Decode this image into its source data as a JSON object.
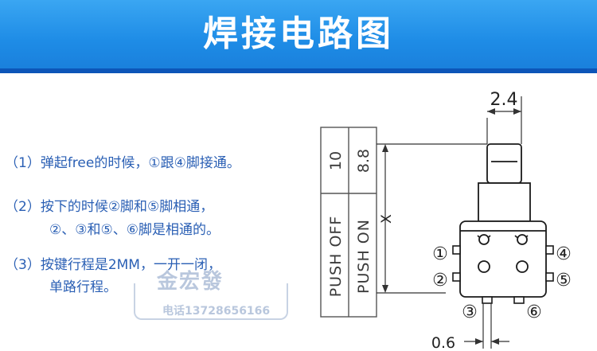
{
  "banner": {
    "title": "焊接电路图"
  },
  "notes": {
    "line1": "（1）弹起free的时候，①跟④脚接通。",
    "line2": "（2）按下的时候②脚和⑤脚相通，",
    "line3": "②、③和⑤、⑥脚是相通的。",
    "line4": "（3）按键行程是2MM，一开一闭，",
    "line5": "单路行程。"
  },
  "watermark": {
    "name": "金宏發",
    "phone": "电话13728656166"
  },
  "table": {
    "col1_value": "10",
    "col2_value": "8.8",
    "col1_label": "PUSH OFF",
    "col2_label": "PUSH ON"
  },
  "dimensions": {
    "top_width": "2.4",
    "stroke": "X",
    "pin_width": "0.6"
  },
  "pins": {
    "p1": "①",
    "p2": "②",
    "p3": "③",
    "p4": "④",
    "p5": "⑤",
    "p6": "⑥"
  },
  "colors": {
    "banner": "#1e8ce6",
    "banner_strip": "#0c55b8",
    "note_text": "#2a5fb4",
    "watermark": "#b9c7dd"
  }
}
